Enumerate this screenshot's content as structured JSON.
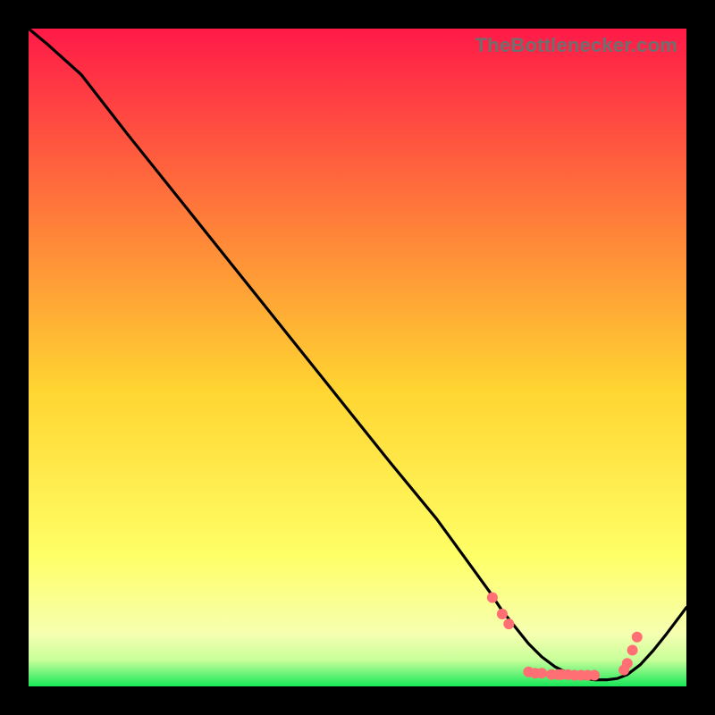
{
  "watermark": "TheBottlenecker.com",
  "colors": {
    "frame": "#000000",
    "line": "#000000",
    "dot": "#ff6f74",
    "grad_top": "#ff1a48",
    "grad_mid_upper": "#ff7a3a",
    "grad_mid": "#ffd531",
    "grad_low": "#ffff66",
    "grad_pale": "#f6ffb0",
    "grad_green": "#17e858"
  },
  "chart_data": {
    "type": "line",
    "title": "",
    "xlabel": "",
    "ylabel": "",
    "xlim": [
      0,
      100
    ],
    "ylim": [
      0,
      100
    ],
    "grid": false,
    "legend": false,
    "series": [
      {
        "name": "curve",
        "x": [
          0,
          3,
          8,
          15,
          25,
          35,
          45,
          55,
          62,
          66,
          70,
          72,
          74,
          76,
          78,
          80,
          82,
          84,
          86,
          88,
          89.5,
          91,
          93,
          95,
          97,
          100
        ],
        "y": [
          100,
          97.5,
          93,
          84,
          71.5,
          59,
          46.5,
          34,
          25.5,
          20,
          14.5,
          11.5,
          9,
          6.5,
          4.5,
          3,
          2,
          1.3,
          1,
          1,
          1.2,
          1.8,
          3.3,
          5.5,
          8,
          12
        ]
      }
    ],
    "markers": [
      {
        "x": 70.5,
        "y": 13.5
      },
      {
        "x": 72.0,
        "y": 11.0
      },
      {
        "x": 73.0,
        "y": 9.5
      },
      {
        "x": 76.0,
        "y": 2.2
      },
      {
        "x": 77.0,
        "y": 2.0
      },
      {
        "x": 78.0,
        "y": 2.0
      },
      {
        "x": 79.5,
        "y": 1.8
      },
      {
        "x": 80.5,
        "y": 1.8
      },
      {
        "x": 81.0,
        "y": 1.8
      },
      {
        "x": 82.0,
        "y": 1.8
      },
      {
        "x": 83.0,
        "y": 1.7
      },
      {
        "x": 84.0,
        "y": 1.7
      },
      {
        "x": 85.0,
        "y": 1.7
      },
      {
        "x": 86.0,
        "y": 1.7
      },
      {
        "x": 90.5,
        "y": 2.5
      },
      {
        "x": 91.0,
        "y": 3.5
      },
      {
        "x": 91.8,
        "y": 5.5
      },
      {
        "x": 92.5,
        "y": 7.5
      }
    ]
  }
}
